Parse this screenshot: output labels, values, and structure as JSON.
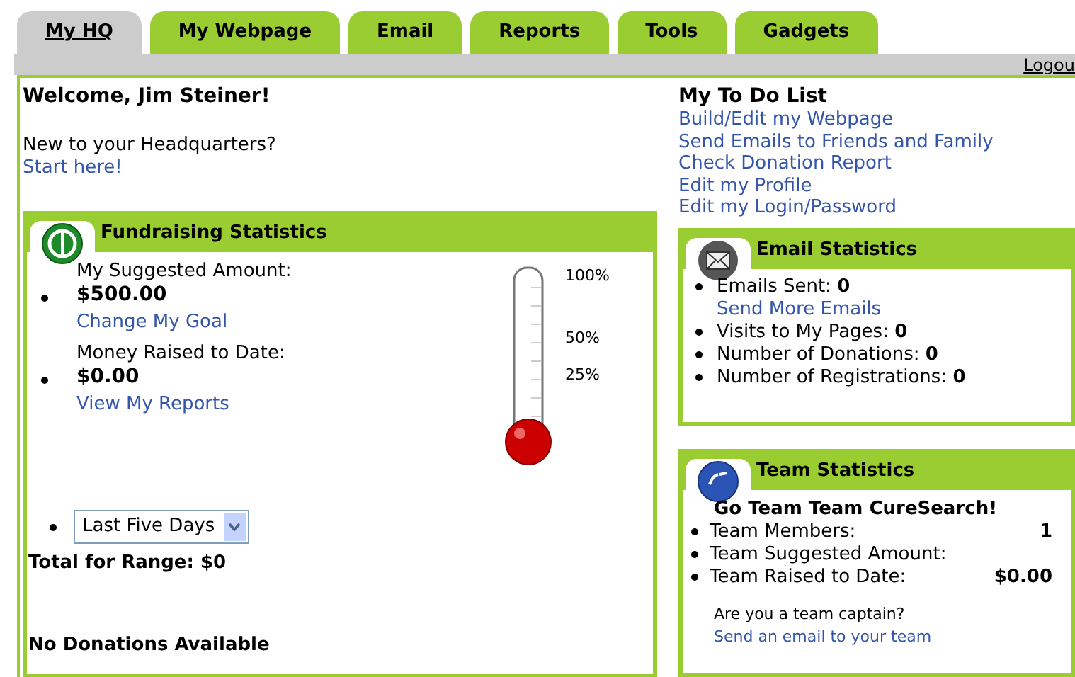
{
  "tabs": [
    {
      "label": "My HQ",
      "selected": true
    },
    {
      "label": "My Webpage",
      "selected": false
    },
    {
      "label": "Email",
      "selected": false
    },
    {
      "label": "Reports",
      "selected": false
    },
    {
      "label": "Tools",
      "selected": false
    },
    {
      "label": "Gadgets",
      "selected": false
    }
  ],
  "logout": "Logou",
  "welcome": "Welcome, Jim Steiner!",
  "intro": "New to your Headquarters?",
  "start_link": "Start here!",
  "todo": {
    "title": "My To Do List",
    "links": [
      "Build/Edit my Webpage",
      "Send Emails to Friends and Family",
      "Check Donation Report",
      "Edit my Profile",
      "Edit my Login/Password"
    ]
  },
  "fundraising": {
    "title": "Fundraising Statistics",
    "items": [
      {
        "label": "My Suggested Amount:",
        "value": "$500.00",
        "link": "Change My Goal"
      },
      {
        "label": "Money Raised to Date:",
        "value": "$0.00",
        "link": "View My Reports"
      }
    ],
    "thermometer": {
      "ticks": [
        "100%",
        "50%",
        "25%"
      ]
    },
    "range_select": {
      "value": "Last Five Days"
    },
    "total": "Total for Range: $0",
    "no_donations": "No Donations Available"
  },
  "email": {
    "title": "Email Statistics",
    "items": [
      {
        "label": "Emails Sent:",
        "value": "0",
        "link": "Send More Emails"
      },
      {
        "label": "Visits to My Pages:",
        "value": "0"
      },
      {
        "label": "Number of Donations:",
        "value": "0"
      },
      {
        "label": "Number of Registrations:",
        "value": "0"
      }
    ]
  },
  "team": {
    "title": "Team Statistics",
    "name": "Go Team Team CureSearch!",
    "rows": [
      {
        "label": "Team Members:",
        "value": "1"
      },
      {
        "label": "Team Suggested Amount:"
      },
      {
        "label": "Team Raised to Date:",
        "value": "$0.00"
      }
    ],
    "captain_question": "Are you a team captain?",
    "captain_link": "Send an email to your team"
  }
}
